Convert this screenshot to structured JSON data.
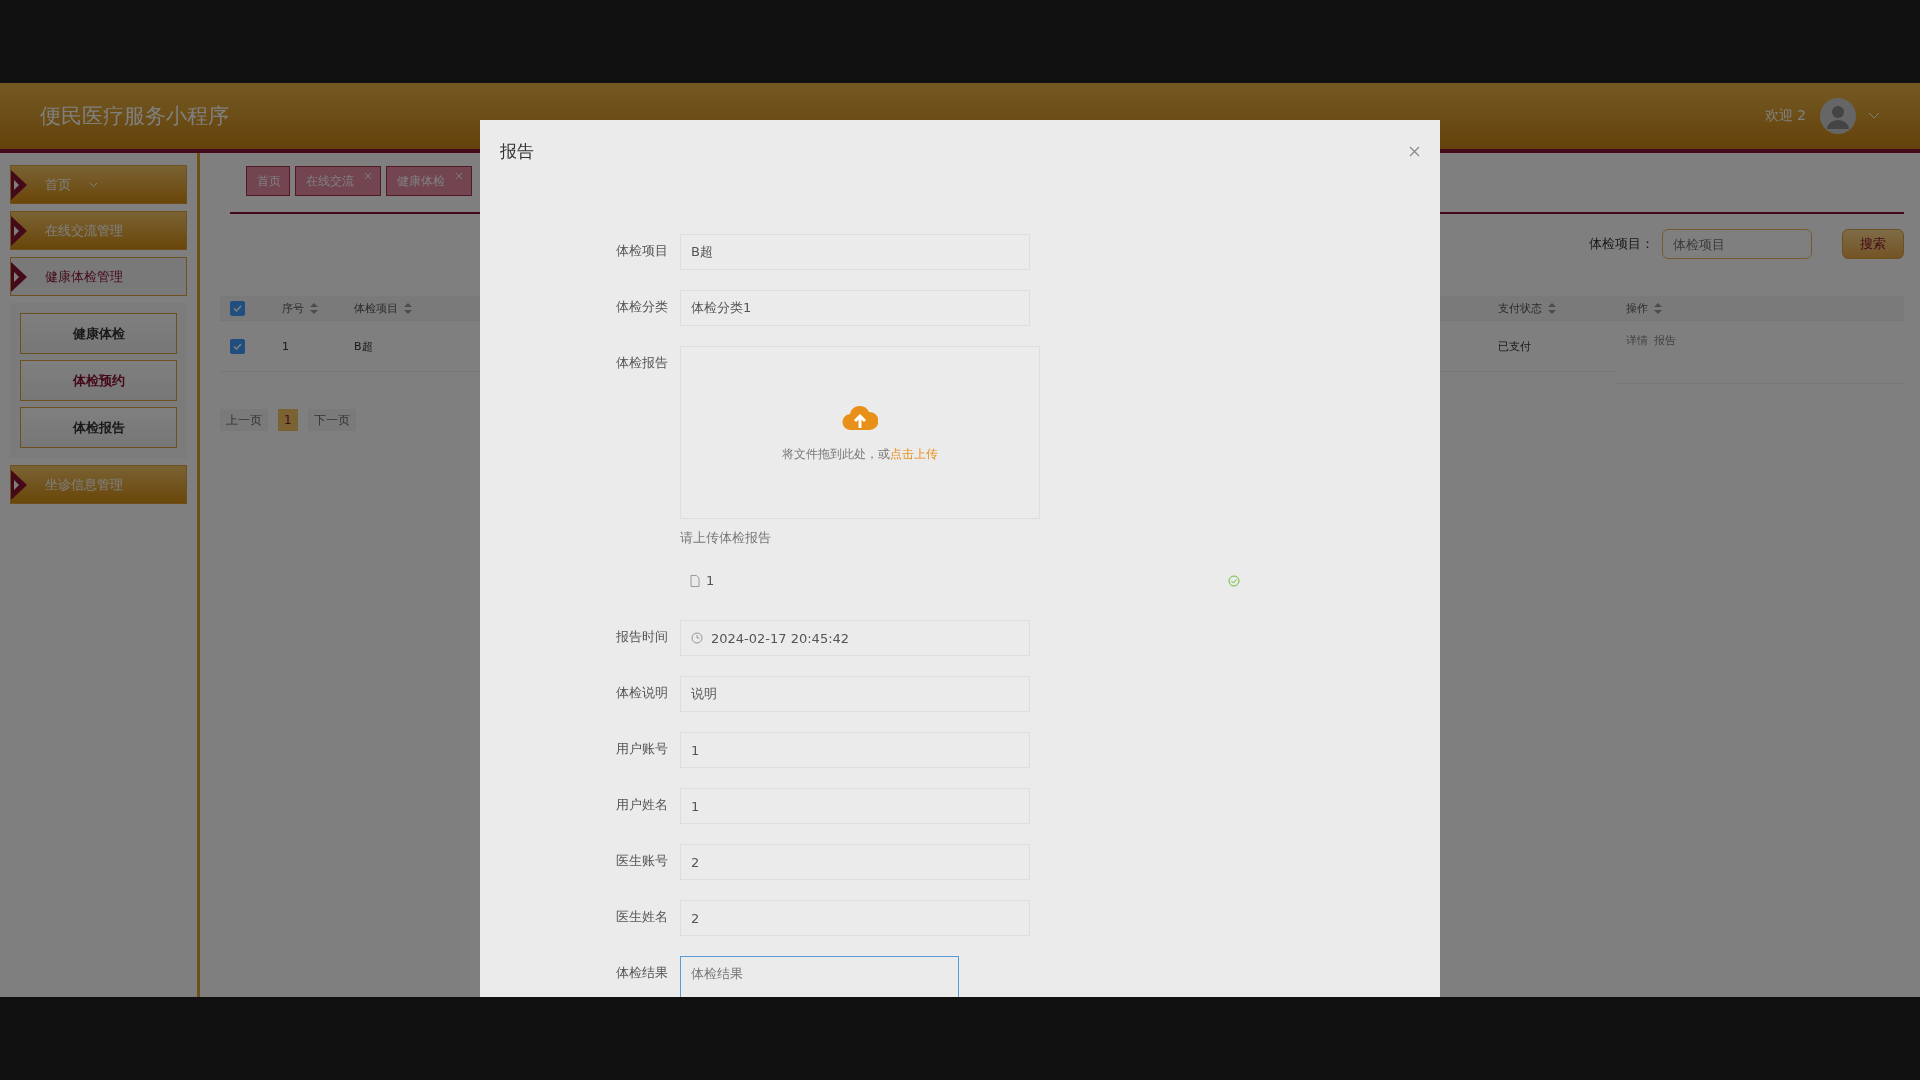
{
  "app": {
    "title": "便民医疗服务小程序",
    "welcome": "欢迎 2"
  },
  "sidebar": {
    "items": [
      {
        "label": "首页",
        "kind": "menu",
        "selected": false
      },
      {
        "label": "在线交流管理",
        "kind": "group",
        "selected": false
      },
      {
        "label": "健康体检管理",
        "kind": "group",
        "selected": true,
        "children": [
          {
            "label": "健康体检",
            "selected": false
          },
          {
            "label": "体检预约",
            "selected": true
          },
          {
            "label": "体检报告",
            "selected": false
          }
        ]
      },
      {
        "label": "坐诊信息管理",
        "kind": "group",
        "selected": false
      }
    ]
  },
  "tabs": [
    {
      "label": "首页",
      "closable": false
    },
    {
      "label": "在线交流",
      "closable": true
    },
    {
      "label": "健康体检",
      "closable": true
    }
  ],
  "search": {
    "label": "体检项目：",
    "placeholder": "体检项目",
    "button": "搜索"
  },
  "table": {
    "all_checked": true,
    "columns": [
      {
        "label": "序号"
      },
      {
        "label": "体检项目"
      },
      {
        "label": "支付状态"
      },
      {
        "label": "操作"
      }
    ],
    "rows": [
      {
        "checked": true,
        "cells": [
          "1",
          "B超",
          "已支付"
        ],
        "actions": [
          "详情",
          "报告"
        ]
      }
    ]
  },
  "pagination": {
    "prev": "上一页",
    "pages": [
      {
        "label": "1",
        "selected": true
      }
    ],
    "next": "下一页"
  },
  "modal": {
    "title": "报告",
    "fields": [
      {
        "kind": "text",
        "label": "体检项目",
        "value": "B超"
      },
      {
        "kind": "text",
        "label": "体检分类",
        "value": "体检分类1"
      },
      {
        "kind": "upload",
        "label": "体检报告",
        "prompt": "将文件拖到此处，或",
        "link": "点击上传",
        "hint": "请上传体检报告",
        "files": [
          {
            "name": "1",
            "uploaded": true
          }
        ]
      },
      {
        "kind": "datetime",
        "label": "报告时间",
        "value": "2024-02-17 20:45:42"
      },
      {
        "kind": "text",
        "label": "体检说明",
        "value": "说明"
      },
      {
        "kind": "text",
        "label": "用户账号",
        "value": "1"
      },
      {
        "kind": "text",
        "label": "用户姓名",
        "value": "1"
      },
      {
        "kind": "text",
        "label": "医生账号",
        "value": "2"
      },
      {
        "kind": "text",
        "label": "医生姓名",
        "value": "2"
      },
      {
        "kind": "textarea",
        "label": "体检结果",
        "placeholder": "体检结果",
        "focused": true
      }
    ]
  }
}
